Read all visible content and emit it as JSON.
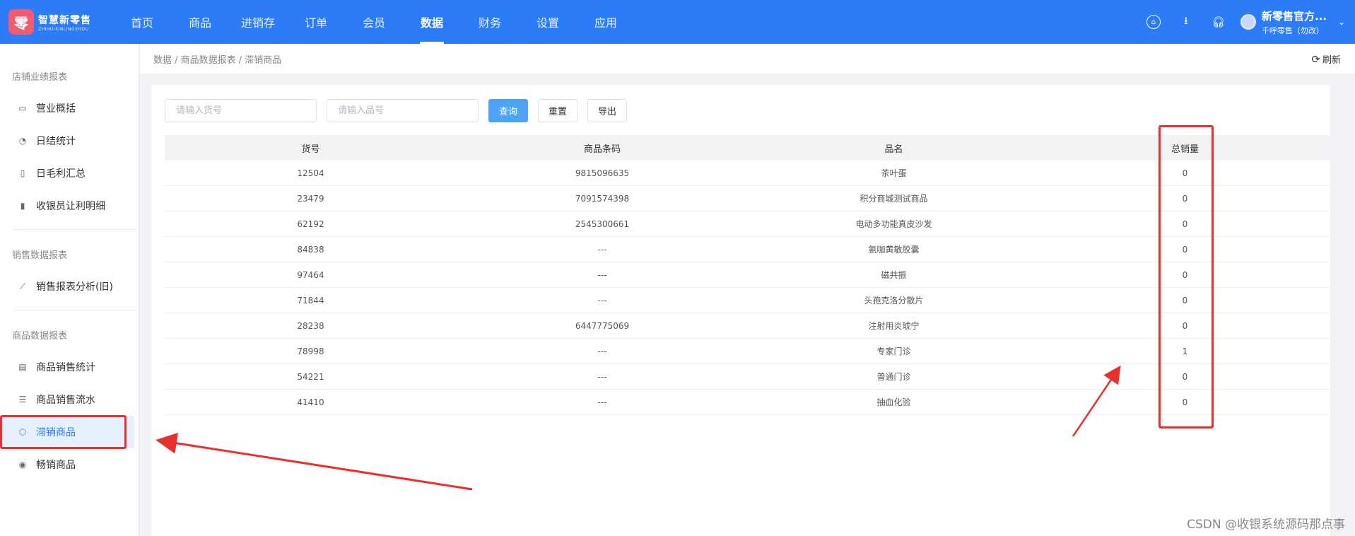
{
  "header": {
    "logo": {
      "badge": "零",
      "title": "智慧新零售",
      "subtitle": "ZHIHUIXINLINGSHOU"
    },
    "nav": [
      "首页",
      "商品",
      "进销存",
      "订单",
      "会员",
      "数据",
      "财务",
      "设置",
      "应用"
    ],
    "active_nav": "数据",
    "icons": [
      "home-icon",
      "download-icon",
      "headset-icon"
    ],
    "user": {
      "name": "新零售官方...",
      "sub": "千呼零售（勿改）"
    }
  },
  "sidebar": {
    "groups": [
      {
        "title": "店铺业绩报表",
        "items": [
          {
            "label": "营业概括",
            "icon": "monitor-icon"
          },
          {
            "label": "日结统计",
            "icon": "pie-icon"
          },
          {
            "label": "日毛利汇总",
            "icon": "receipt-icon"
          },
          {
            "label": "收银员让利明细",
            "icon": "cashier-icon"
          }
        ]
      },
      {
        "title": "销售数据报表",
        "items": [
          {
            "label": "销售报表分析(旧)",
            "icon": "line-chart-icon"
          }
        ]
      },
      {
        "title": "商品数据报表",
        "items": [
          {
            "label": "商品销售统计",
            "icon": "document-icon"
          },
          {
            "label": "商品销售流水",
            "icon": "list-icon"
          },
          {
            "label": "滞销商品",
            "icon": "cube-icon"
          },
          {
            "label": "畅销商品",
            "icon": "badge-icon"
          }
        ]
      }
    ],
    "active_item": "滞销商品"
  },
  "breadcrumb": "数据 / 商品数据报表 / 滞销商品",
  "refresh_label": "刷新",
  "filters": {
    "sku_placeholder": "请输入货号",
    "name_placeholder": "请输入品号",
    "query_label": "查询",
    "reset_label": "重置",
    "export_label": "导出"
  },
  "table": {
    "columns": [
      "货号",
      "商品条码",
      "品名",
      "总销量"
    ],
    "rows": [
      [
        "12504",
        "9815096635",
        "茶叶蛋",
        "0"
      ],
      [
        "23479",
        "7091574398",
        "积分商城测试商品",
        "0"
      ],
      [
        "62192",
        "2545300661",
        "电动多功能真皮沙发",
        "0"
      ],
      [
        "84838",
        "---",
        "氨咖黄敏胶囊",
        "0"
      ],
      [
        "97464",
        "---",
        "磁共振",
        "0"
      ],
      [
        "71844",
        "---",
        "头孢克洛分散片",
        "0"
      ],
      [
        "28238",
        "6447775069",
        "注射用炎琥宁",
        "0"
      ],
      [
        "78998",
        "---",
        "专家门诊",
        "1"
      ],
      [
        "54221",
        "---",
        "普通门诊",
        "0"
      ],
      [
        "41410",
        "---",
        "抽血化验",
        "0"
      ]
    ]
  },
  "colors": {
    "header": "#2b7cf6",
    "primary_button": "#4ca3f7",
    "annotation": "#e8302f"
  },
  "watermark": "CSDN @收银系统源码那点事"
}
